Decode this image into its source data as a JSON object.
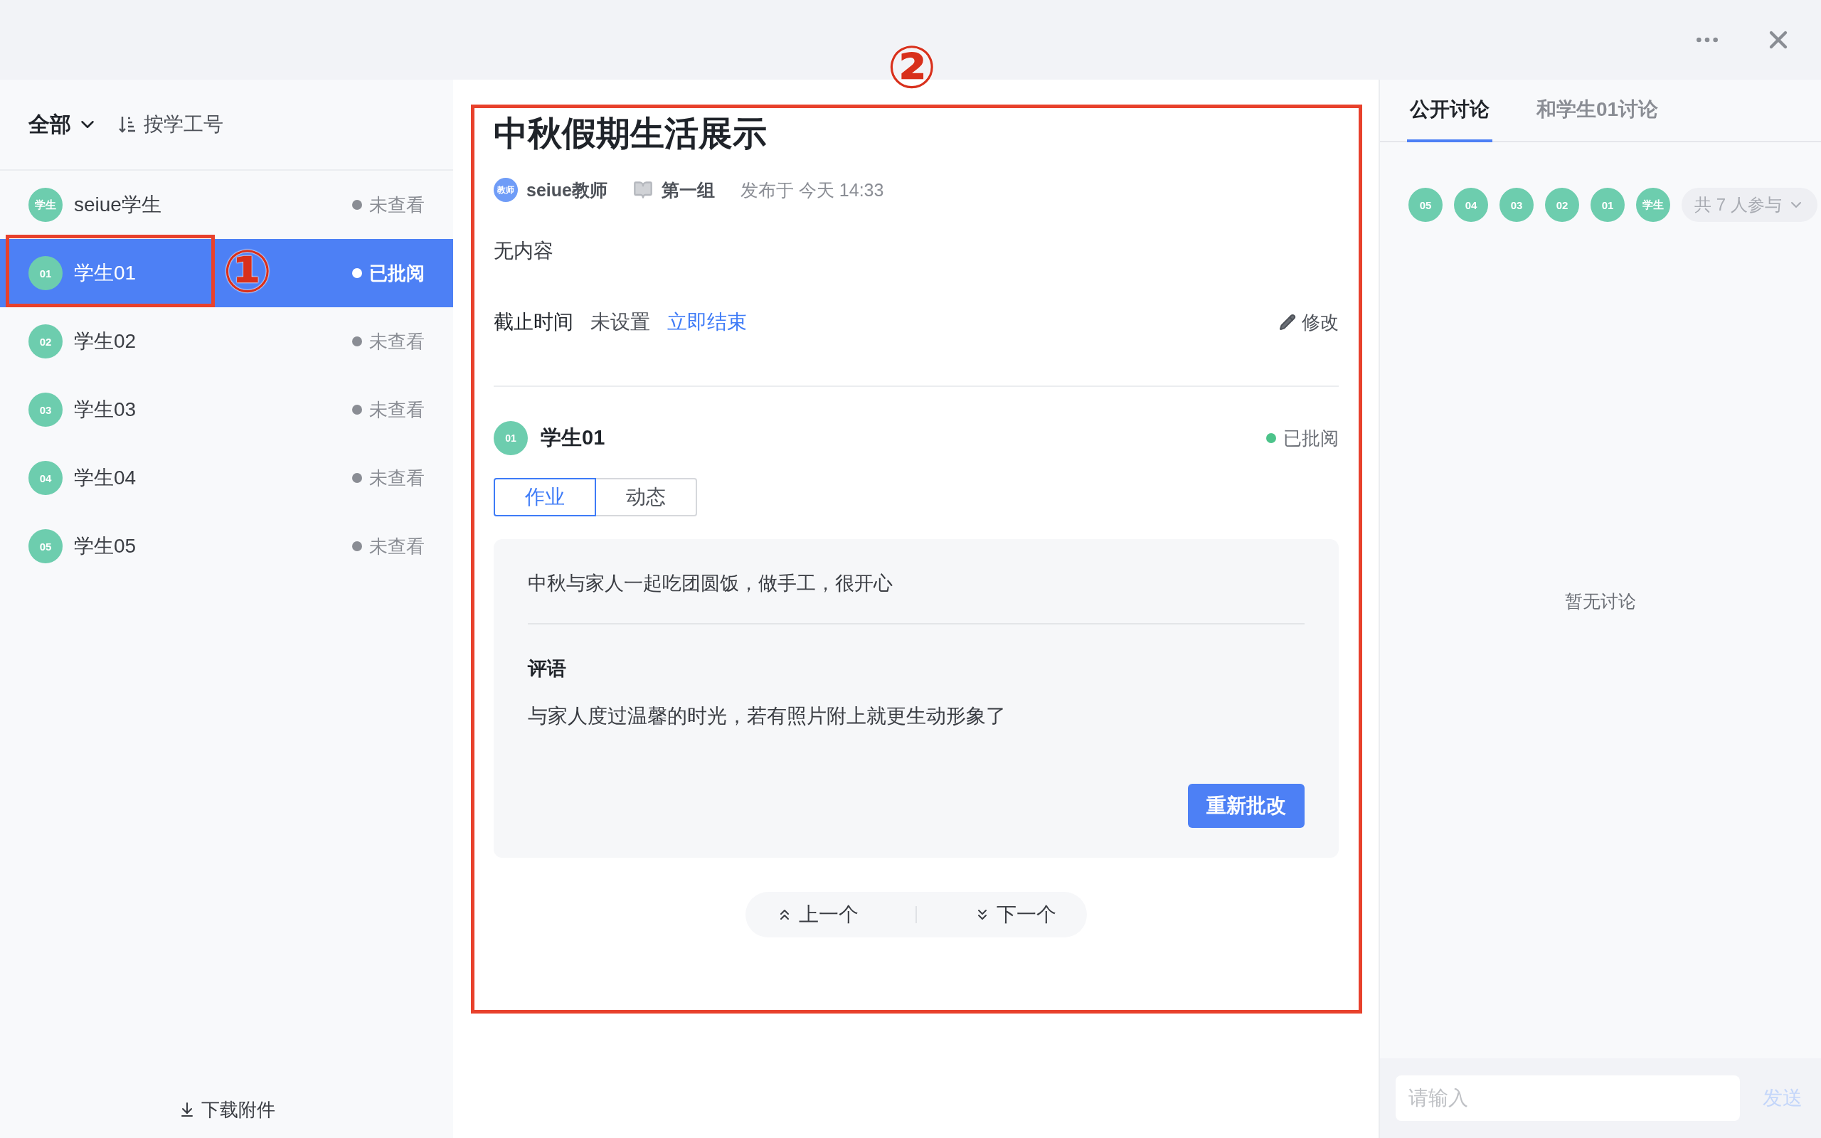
{
  "student_list": {
    "filter": "全部",
    "sort": "按学工号",
    "items": [
      {
        "avatar": "学生",
        "name": "seiue学生",
        "status": "未查看",
        "selected": false
      },
      {
        "avatar": "01",
        "name": "学生01",
        "status": "已批阅",
        "selected": true
      },
      {
        "avatar": "02",
        "name": "学生02",
        "status": "未查看",
        "selected": false
      },
      {
        "avatar": "03",
        "name": "学生03",
        "status": "未查看",
        "selected": false
      },
      {
        "avatar": "04",
        "name": "学生04",
        "status": "未查看",
        "selected": false
      },
      {
        "avatar": "05",
        "name": "学生05",
        "status": "未查看",
        "selected": false
      }
    ],
    "download": "下载附件"
  },
  "assignment": {
    "title": "中秋假期生活展示",
    "author_avatar": "教师",
    "author": "seiue教师",
    "group": "第一组",
    "published": "发布于 今天 14:33",
    "content": "无内容",
    "deadline_label": "截止时间",
    "deadline_value": "未设置",
    "end_now": "立即结束",
    "edit": "修改"
  },
  "submission": {
    "avatar": "01",
    "student": "学生01",
    "status": "已批阅",
    "tabs": [
      {
        "label": "作业",
        "selected": true
      },
      {
        "label": "动态",
        "selected": false
      }
    ],
    "answer": "中秋与家人一起吃团圆饭，做手工，很开心",
    "comment_label": "评语",
    "comment": "与家人度过温馨的时光，若有照片附上就更生动形象了",
    "regrade_button": "重新批改"
  },
  "navigation": {
    "prev": "上一个",
    "next": "下一个"
  },
  "discussion": {
    "tabs": [
      {
        "label": "公开讨论",
        "selected": true
      },
      {
        "label": "和学生01讨论",
        "selected": false
      }
    ],
    "participants": [
      "05",
      "04",
      "03",
      "02",
      "01",
      "学生"
    ],
    "participant_count": "共 7 人参与",
    "empty": "暂无讨论",
    "input": {
      "placeholder": "请输入"
    },
    "send": "发送"
  },
  "annotations": [
    {
      "label": "①"
    },
    {
      "label": "②"
    }
  ]
}
